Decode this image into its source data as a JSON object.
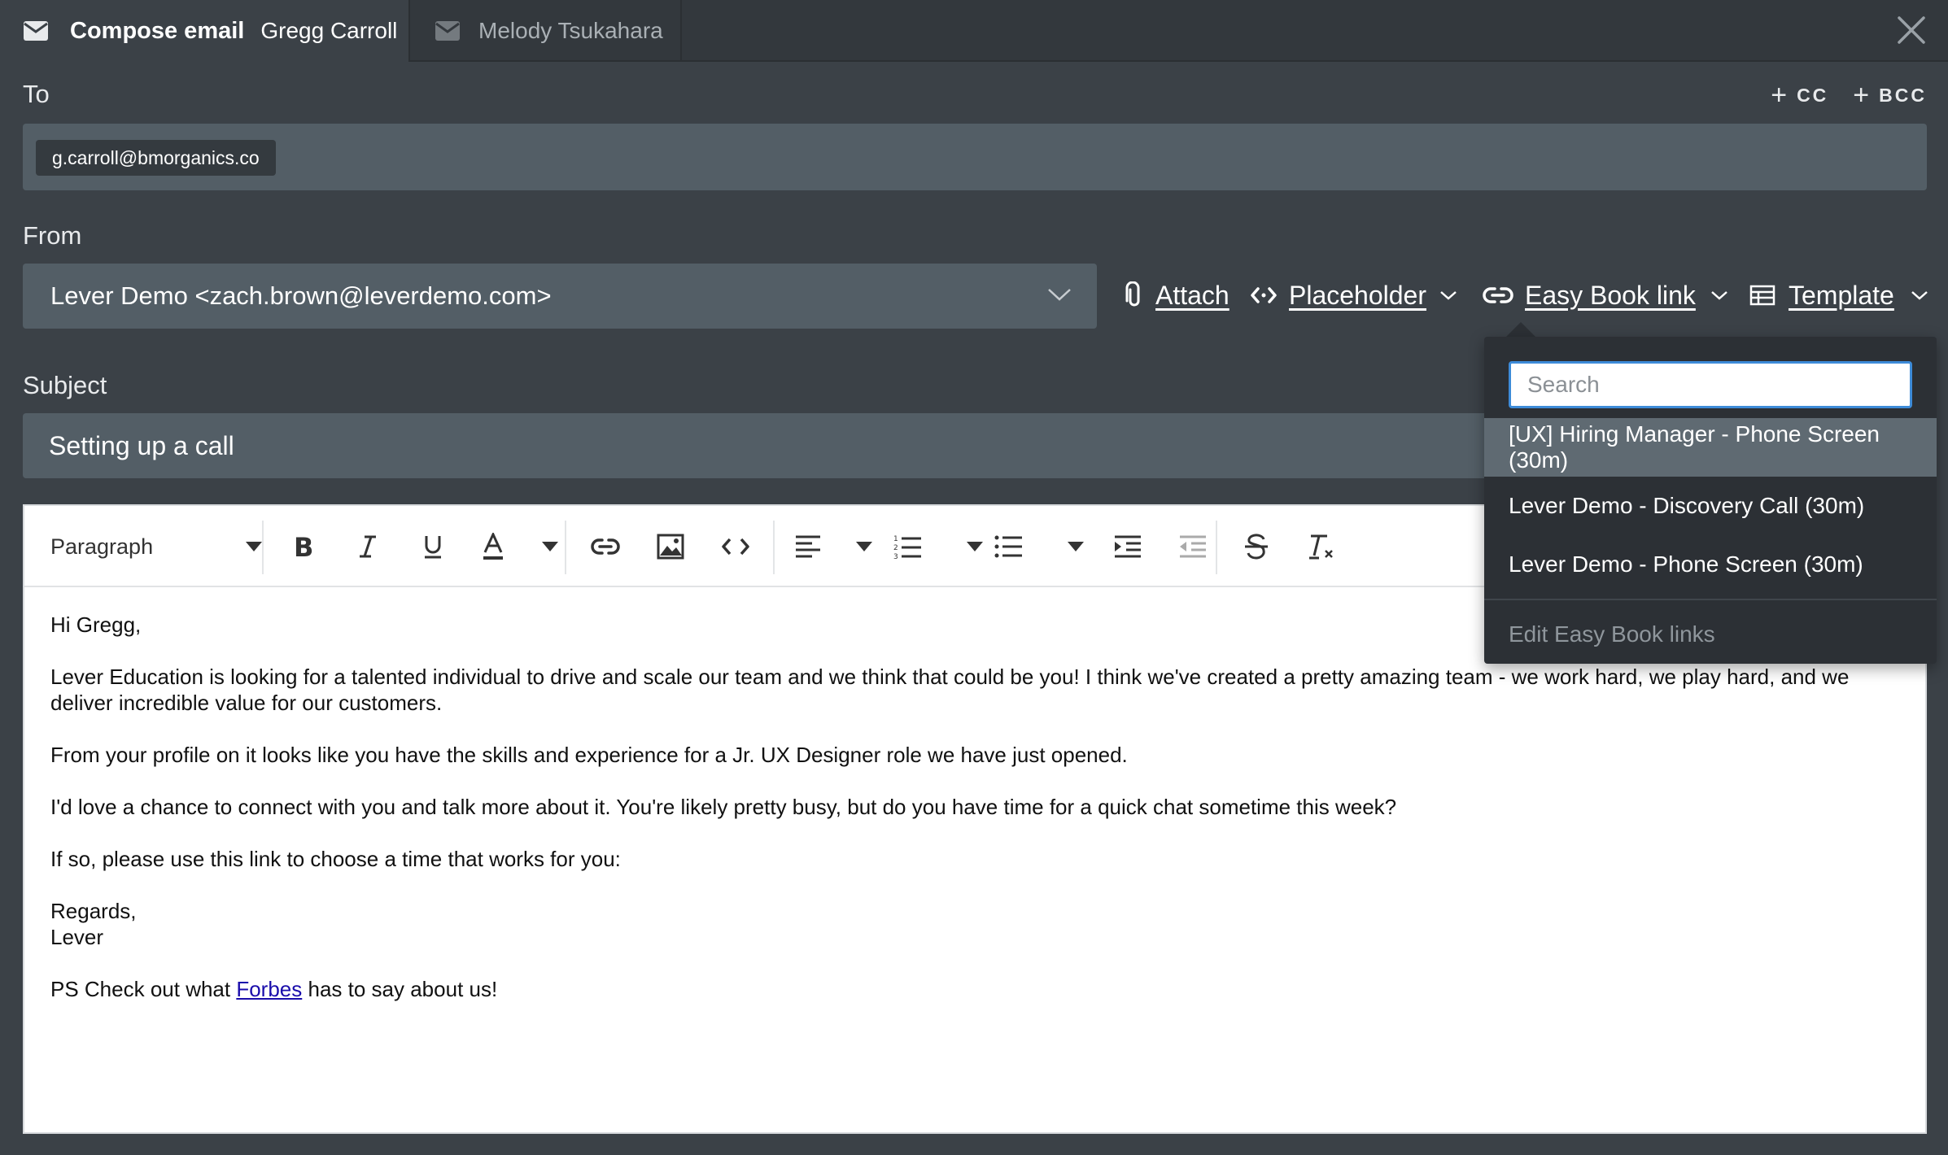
{
  "tabs": {
    "active": {
      "title": "Compose email",
      "name": "Gregg Carroll"
    },
    "inactive": {
      "name": "Melody Tsukahara"
    }
  },
  "to": {
    "label": "To",
    "recipients": [
      "g.carroll@bmorganics.co"
    ],
    "cc_label": "CC",
    "bcc_label": "BCC"
  },
  "from": {
    "label": "From",
    "value": "Lever Demo <zach.brown@leverdemo.com>"
  },
  "actions": {
    "attach": "Attach",
    "placeholder": "Placeholder",
    "easy_book": "Easy Book link",
    "template": "Template"
  },
  "subject": {
    "label": "Subject",
    "value": "Setting up a call"
  },
  "toolbar": {
    "block_format": "Paragraph"
  },
  "body": {
    "greeting": "Hi Gregg,",
    "p1": "Lever Education is looking for a talented individual to drive and scale our team and we think that could be you! I think we've created a pretty amazing team - we work hard, we play hard, and we deliver incredible value for our customers.",
    "p2": "From your profile on it looks like you have the skills and experience for a Jr. UX Designer role we have just opened.",
    "p3": "I'd love a chance to connect with you and talk more about it. You're likely pretty busy, but do you have time for a quick chat sometime this week?",
    "p4": "If so, please use this link to choose a time that works for you:",
    "signoff": "Regards,",
    "signature": "Lever",
    "ps_prefix": "PS Check out what ",
    "ps_link": "Forbes",
    "ps_suffix": " has to say about us!"
  },
  "easy_book_dropdown": {
    "search_placeholder": "Search",
    "items": [
      "[UX] Hiring Manager - Phone Screen (30m)",
      "Lever Demo - Discovery Call (30m)",
      "Lever Demo - Phone Screen (30m)"
    ],
    "selected_index": 0,
    "footer": "Edit Easy Book links"
  },
  "colors": {
    "background": "#3b4147",
    "field": "#535e66",
    "dropdown": "#2c3035",
    "selected": "#5f6a72",
    "focus": "#3d8bd8",
    "link": "#1a0dab"
  }
}
